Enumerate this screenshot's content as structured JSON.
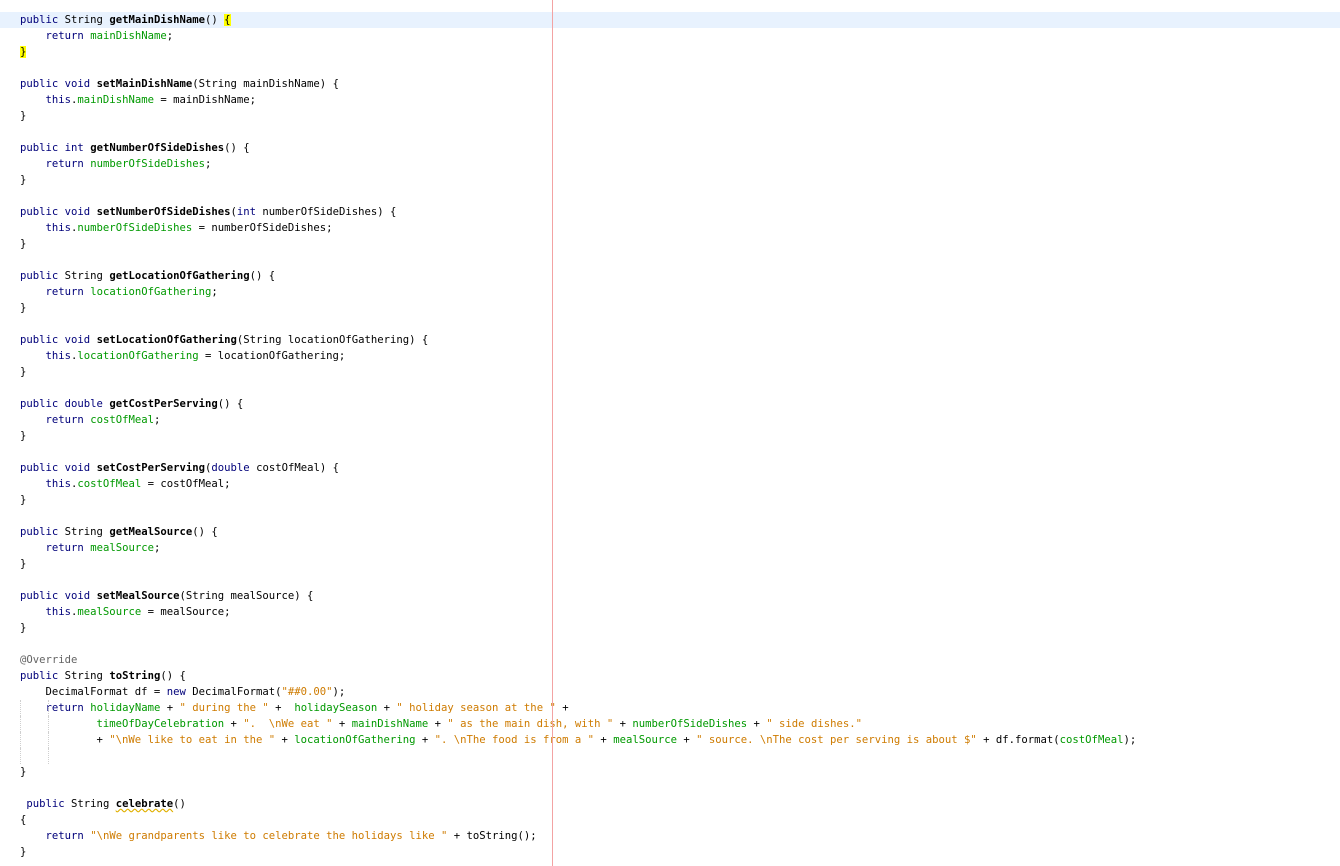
{
  "editor": {
    "current_line": 0,
    "lines": [
      [
        {
          "t": "public",
          "c": "kw"
        },
        {
          "t": " String "
        },
        {
          "t": "getMainDishName",
          "c": "bold"
        },
        {
          "t": "() "
        },
        {
          "t": "{",
          "c": "match"
        }
      ],
      [
        {
          "t": "    "
        },
        {
          "t": "return",
          "c": "kw"
        },
        {
          "t": " "
        },
        {
          "t": "mainDishName",
          "c": "fld"
        },
        {
          "t": ";"
        }
      ],
      [
        {
          "t": "}",
          "c": "match"
        }
      ],
      [],
      [
        {
          "t": "public",
          "c": "kw"
        },
        {
          "t": " "
        },
        {
          "t": "void",
          "c": "kw"
        },
        {
          "t": " "
        },
        {
          "t": "setMainDishName",
          "c": "bold"
        },
        {
          "t": "(String mainDishName) {"
        }
      ],
      [
        {
          "t": "    "
        },
        {
          "t": "this",
          "c": "kw"
        },
        {
          "t": "."
        },
        {
          "t": "mainDishName",
          "c": "fld"
        },
        {
          "t": " = mainDishName;"
        }
      ],
      [
        {
          "t": "}"
        }
      ],
      [],
      [
        {
          "t": "public",
          "c": "kw"
        },
        {
          "t": " "
        },
        {
          "t": "int",
          "c": "kw"
        },
        {
          "t": " "
        },
        {
          "t": "getNumberOfSideDishes",
          "c": "bold"
        },
        {
          "t": "() {"
        }
      ],
      [
        {
          "t": "    "
        },
        {
          "t": "return",
          "c": "kw"
        },
        {
          "t": " "
        },
        {
          "t": "numberOfSideDishes",
          "c": "fld"
        },
        {
          "t": ";"
        }
      ],
      [
        {
          "t": "}"
        }
      ],
      [],
      [
        {
          "t": "public",
          "c": "kw"
        },
        {
          "t": " "
        },
        {
          "t": "void",
          "c": "kw"
        },
        {
          "t": " "
        },
        {
          "t": "setNumberOfSideDishes",
          "c": "bold"
        },
        {
          "t": "("
        },
        {
          "t": "int",
          "c": "kw"
        },
        {
          "t": " numberOfSideDishes) {"
        }
      ],
      [
        {
          "t": "    "
        },
        {
          "t": "this",
          "c": "kw"
        },
        {
          "t": "."
        },
        {
          "t": "numberOfSideDishes",
          "c": "fld"
        },
        {
          "t": " = numberOfSideDishes;"
        }
      ],
      [
        {
          "t": "}"
        }
      ],
      [],
      [
        {
          "t": "public",
          "c": "kw"
        },
        {
          "t": " String "
        },
        {
          "t": "getLocationOfGathering",
          "c": "bold"
        },
        {
          "t": "() {"
        }
      ],
      [
        {
          "t": "    "
        },
        {
          "t": "return",
          "c": "kw"
        },
        {
          "t": " "
        },
        {
          "t": "locationOfGathering",
          "c": "fld"
        },
        {
          "t": ";"
        }
      ],
      [
        {
          "t": "}"
        }
      ],
      [],
      [
        {
          "t": "public",
          "c": "kw"
        },
        {
          "t": " "
        },
        {
          "t": "void",
          "c": "kw"
        },
        {
          "t": " "
        },
        {
          "t": "setLocationOfGathering",
          "c": "bold"
        },
        {
          "t": "(String locationOfGathering) {"
        }
      ],
      [
        {
          "t": "    "
        },
        {
          "t": "this",
          "c": "kw"
        },
        {
          "t": "."
        },
        {
          "t": "locationOfGathering",
          "c": "fld"
        },
        {
          "t": " = locationOfGathering;"
        }
      ],
      [
        {
          "t": "}"
        }
      ],
      [],
      [
        {
          "t": "public",
          "c": "kw"
        },
        {
          "t": " "
        },
        {
          "t": "double",
          "c": "kw"
        },
        {
          "t": " "
        },
        {
          "t": "getCostPerServing",
          "c": "bold"
        },
        {
          "t": "() {"
        }
      ],
      [
        {
          "t": "    "
        },
        {
          "t": "return",
          "c": "kw"
        },
        {
          "t": " "
        },
        {
          "t": "costOfMeal",
          "c": "fld"
        },
        {
          "t": ";"
        }
      ],
      [
        {
          "t": "}"
        }
      ],
      [],
      [
        {
          "t": "public",
          "c": "kw"
        },
        {
          "t": " "
        },
        {
          "t": "void",
          "c": "kw"
        },
        {
          "t": " "
        },
        {
          "t": "setCostPerServing",
          "c": "bold"
        },
        {
          "t": "("
        },
        {
          "t": "double",
          "c": "kw"
        },
        {
          "t": " costOfMeal) {"
        }
      ],
      [
        {
          "t": "    "
        },
        {
          "t": "this",
          "c": "kw"
        },
        {
          "t": "."
        },
        {
          "t": "costOfMeal",
          "c": "fld"
        },
        {
          "t": " = costOfMeal;"
        }
      ],
      [
        {
          "t": "}"
        }
      ],
      [],
      [
        {
          "t": "public",
          "c": "kw"
        },
        {
          "t": " String "
        },
        {
          "t": "getMealSource",
          "c": "bold"
        },
        {
          "t": "() {"
        }
      ],
      [
        {
          "t": "    "
        },
        {
          "t": "return",
          "c": "kw"
        },
        {
          "t": " "
        },
        {
          "t": "mealSource",
          "c": "fld"
        },
        {
          "t": ";"
        }
      ],
      [
        {
          "t": "}"
        }
      ],
      [],
      [
        {
          "t": "public",
          "c": "kw"
        },
        {
          "t": " "
        },
        {
          "t": "void",
          "c": "kw"
        },
        {
          "t": " "
        },
        {
          "t": "setMealSource",
          "c": "bold"
        },
        {
          "t": "(String mealSource) {"
        }
      ],
      [
        {
          "t": "    "
        },
        {
          "t": "this",
          "c": "kw"
        },
        {
          "t": "."
        },
        {
          "t": "mealSource",
          "c": "fld"
        },
        {
          "t": " = mealSource;"
        }
      ],
      [
        {
          "t": "}"
        }
      ],
      [],
      [
        {
          "t": "@Override",
          "c": "ann"
        }
      ],
      [
        {
          "t": "public",
          "c": "kw"
        },
        {
          "t": " String "
        },
        {
          "t": "toString",
          "c": "bold"
        },
        {
          "t": "() {"
        }
      ],
      [
        {
          "t": "    DecimalFormat df = "
        },
        {
          "t": "new",
          "c": "kw"
        },
        {
          "t": " DecimalFormat("
        },
        {
          "t": "\"##0.00\"",
          "c": "str"
        },
        {
          "t": ");"
        }
      ],
      [
        {
          "t": "    "
        },
        {
          "t": "return",
          "c": "kw"
        },
        {
          "t": " "
        },
        {
          "t": "holidayName",
          "c": "fld"
        },
        {
          "t": " + "
        },
        {
          "t": "\" during the \"",
          "c": "str"
        },
        {
          "t": " +  "
        },
        {
          "t": "holidaySeason",
          "c": "fld"
        },
        {
          "t": " + "
        },
        {
          "t": "\" holiday season at the \"",
          "c": "str"
        },
        {
          "t": " +"
        }
      ],
      [
        {
          "t": "            "
        },
        {
          "t": "timeOfDayCelebration",
          "c": "fld"
        },
        {
          "t": " + "
        },
        {
          "t": "\".  \\nWe eat \"",
          "c": "str"
        },
        {
          "t": " + "
        },
        {
          "t": "mainDishName",
          "c": "fld"
        },
        {
          "t": " + "
        },
        {
          "t": "\" as the main dish, with \"",
          "c": "str"
        },
        {
          "t": " + "
        },
        {
          "t": "numberOfSideDishes",
          "c": "fld"
        },
        {
          "t": " + "
        },
        {
          "t": "\" side dishes.\"",
          "c": "str"
        }
      ],
      [
        {
          "t": "            + "
        },
        {
          "t": "\"\\nWe like to eat in the \"",
          "c": "str"
        },
        {
          "t": " + "
        },
        {
          "t": "locationOfGathering",
          "c": "fld"
        },
        {
          "t": " + "
        },
        {
          "t": "\". \\nThe food is from a \"",
          "c": "str"
        },
        {
          "t": " + "
        },
        {
          "t": "mealSource",
          "c": "fld"
        },
        {
          "t": " + "
        },
        {
          "t": "\" source. \\nThe cost per serving is about $\"",
          "c": "str"
        },
        {
          "t": " + df.format("
        },
        {
          "t": "costOfMeal",
          "c": "fld"
        },
        {
          "t": ");"
        }
      ],
      [],
      [
        {
          "t": "}"
        }
      ],
      [],
      [
        {
          "t": " "
        },
        {
          "t": "public",
          "c": "kw"
        },
        {
          "t": " String "
        },
        {
          "t": "celebrate",
          "c": "bold warn"
        },
        {
          "t": "()"
        }
      ],
      [
        {
          "t": "{"
        }
      ],
      [
        {
          "t": "    "
        },
        {
          "t": "return",
          "c": "kw"
        },
        {
          "t": " "
        },
        {
          "t": "\"\\nWe grandparents like to celebrate the holidays like \"",
          "c": "str"
        },
        {
          "t": " + toString();"
        }
      ],
      [
        {
          "t": "}"
        }
      ]
    ]
  }
}
